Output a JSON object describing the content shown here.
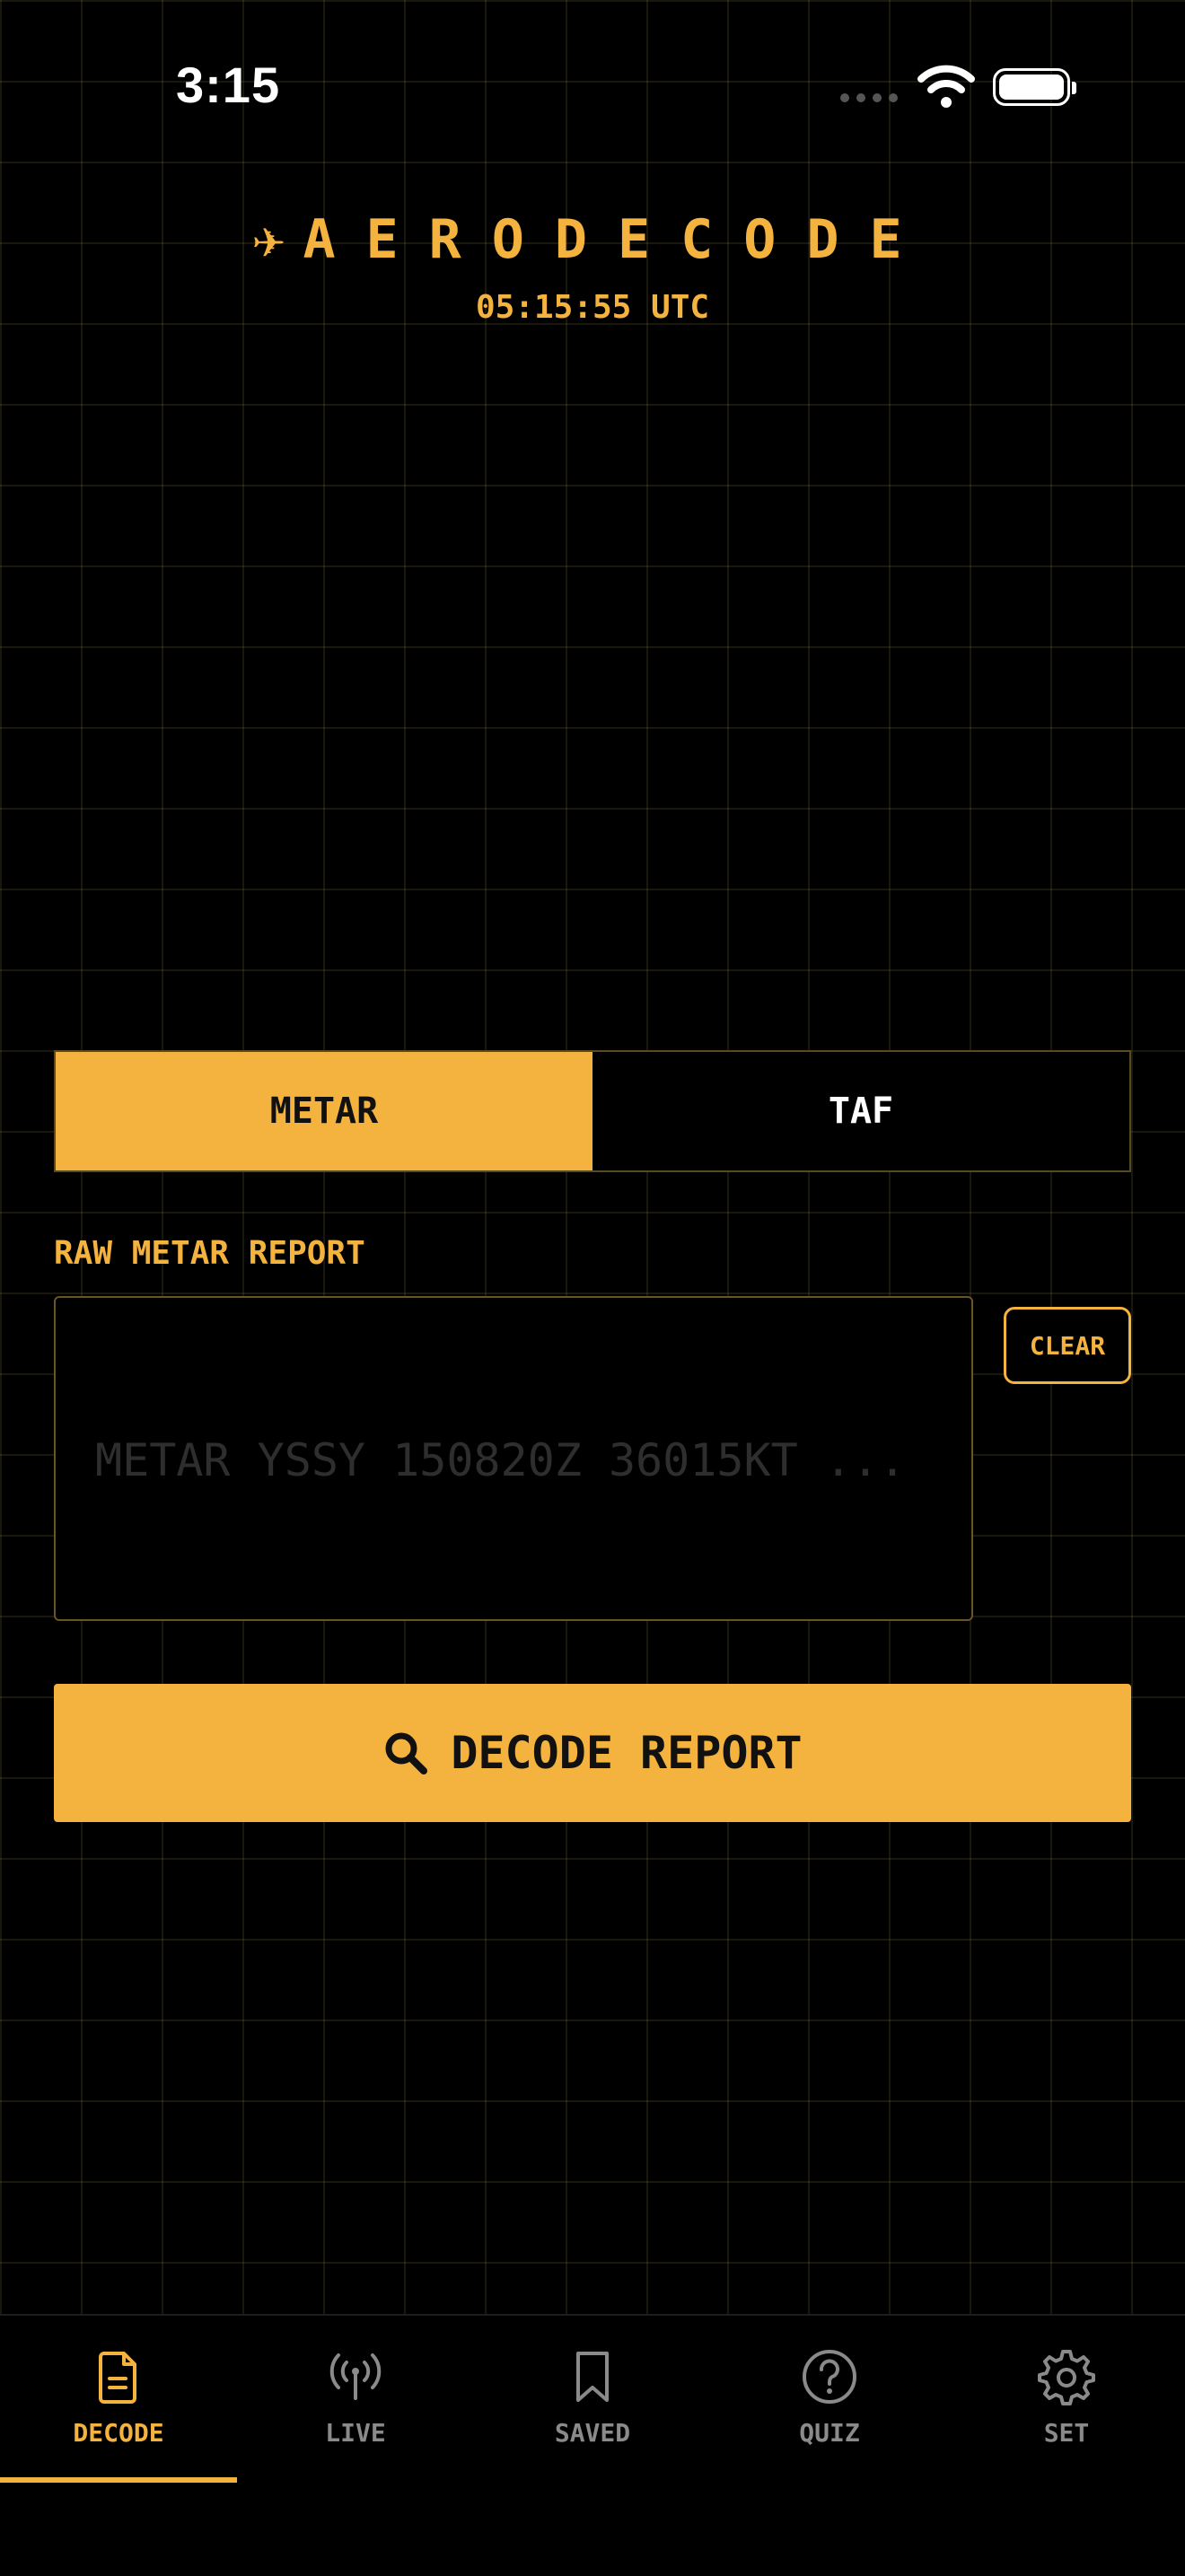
{
  "status": {
    "time": "3:15"
  },
  "header": {
    "plane_glyph": "✈",
    "title": "AERODECODE",
    "utc_clock": "05:15:55 UTC"
  },
  "segment": {
    "options": [
      {
        "label": "METAR",
        "active": true
      },
      {
        "label": "TAF",
        "active": false
      }
    ]
  },
  "input": {
    "label": "RAW METAR REPORT",
    "placeholder": "METAR YSSY 150820Z 36015KT ...",
    "value": "",
    "clear_label": "CLEAR"
  },
  "decode_button": {
    "label": "DECODE REPORT",
    "icon": "search-icon"
  },
  "tabbar": {
    "items": [
      {
        "label": "DECODE",
        "icon": "document-icon",
        "active": true
      },
      {
        "label": "LIVE",
        "icon": "antenna-icon",
        "active": false
      },
      {
        "label": "SAVED",
        "icon": "bookmark-icon",
        "active": false
      },
      {
        "label": "QUIZ",
        "icon": "question-circle-icon",
        "active": false
      },
      {
        "label": "SET",
        "icon": "gear-icon",
        "active": false
      }
    ]
  },
  "colors": {
    "accent": "#F4B23F",
    "background": "#000000",
    "inactive": "#8A8A8A"
  }
}
